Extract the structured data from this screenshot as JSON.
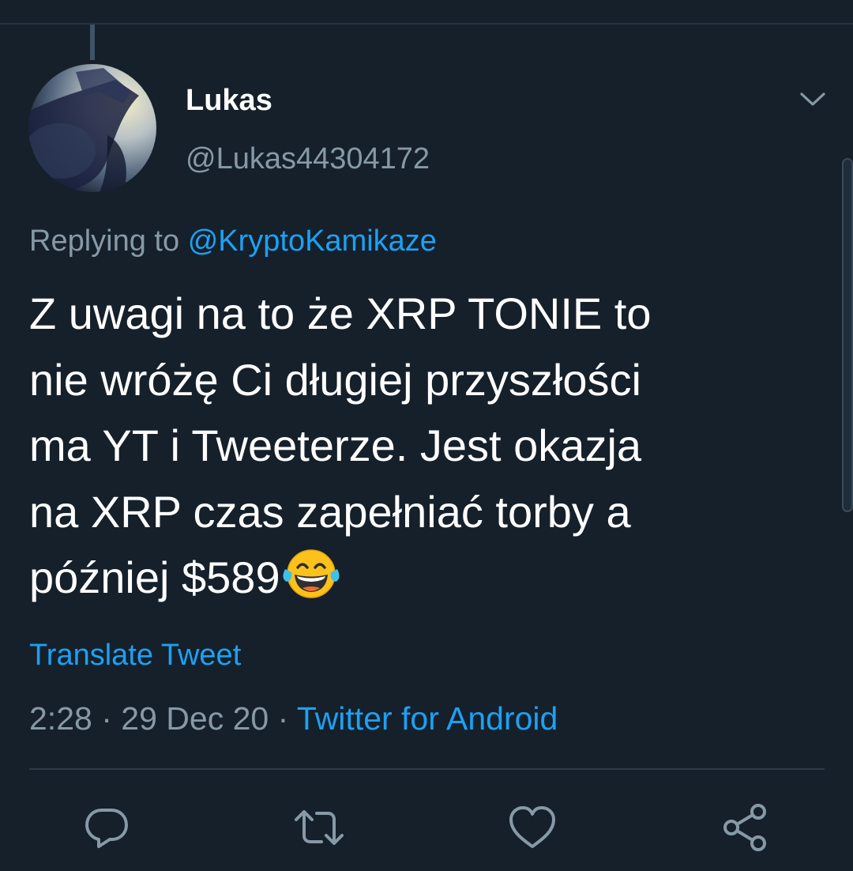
{
  "tweet": {
    "author": {
      "display_name": "Lukas",
      "handle": "@Lukas44304172"
    },
    "replying_to_prefix": "Replying to",
    "replying_to_handle": "@KryptoKamikaze",
    "text_lines": [
      "Z uwagi na to że XRP TONIE to",
      "nie wróżę Ci długiej przyszłości",
      "ma YT i Tweeterze. Jest okazja",
      "na XRP czas zapełniać torby a",
      "później $589"
    ],
    "emoji": "face-with-tears-of-joy",
    "translate_label": "Translate Tweet",
    "time": "2:28",
    "date": "29 Dec 20",
    "separator": "·",
    "source": "Twitter for Android"
  },
  "actions": [
    {
      "name": "reply",
      "icon": "comment-icon"
    },
    {
      "name": "retweet",
      "icon": "retweet-icon"
    },
    {
      "name": "like",
      "icon": "heart-icon"
    },
    {
      "name": "share",
      "icon": "share-icon"
    }
  ],
  "colors": {
    "background": "#15202b",
    "primary_text": "#ffffff",
    "secondary_text": "#8899a6",
    "accent": "#1da1f2",
    "divider": "#2c3b48"
  }
}
